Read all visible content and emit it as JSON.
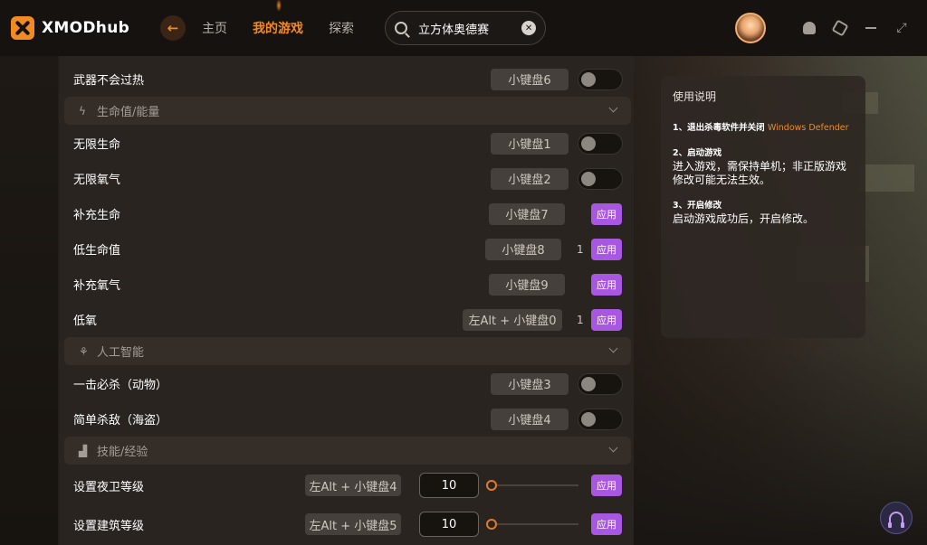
{
  "app": {
    "name": "XMODhub"
  },
  "nav": {
    "items": [
      "主页",
      "我的游戏",
      "探索"
    ],
    "active_index": 1
  },
  "search": {
    "value": "立方体奥德赛"
  },
  "colors": {
    "accent": "#f08a24",
    "apply": "#a857e0",
    "panel": "#2a2420"
  },
  "rows": {
    "r0": {
      "label": "武器不会过热",
      "hotkey": "小键盘6",
      "control": "toggle",
      "on": false
    },
    "sec1": {
      "label": "生命值/能量",
      "icon": "lightning-icon"
    },
    "r1": {
      "label": "无限生命",
      "hotkey": "小键盘1",
      "control": "toggle",
      "on": false
    },
    "r2": {
      "label": "无限氧气",
      "hotkey": "小键盘2",
      "control": "toggle",
      "on": false
    },
    "r3": {
      "label": "补充生命",
      "hotkey": "小键盘7",
      "apply": "应用"
    },
    "r4": {
      "label": "低生命值",
      "hotkey": "小键盘8",
      "value": "1",
      "apply": "应用"
    },
    "r5": {
      "label": "补充氧气",
      "hotkey": "小键盘9",
      "apply": "应用"
    },
    "r6": {
      "label": "低氧",
      "hotkey": "左Alt + 小键盘0",
      "value": "1",
      "apply": "应用"
    },
    "sec2": {
      "label": "人工智能",
      "icon": "ai-icon"
    },
    "r7": {
      "label": "一击必杀（动物）",
      "hotkey": "小键盘3",
      "control": "toggle",
      "on": false
    },
    "r8": {
      "label": "简单杀敌（海盗）",
      "hotkey": "小键盘4",
      "control": "toggle",
      "on": false
    },
    "sec3": {
      "label": "技能/经验",
      "icon": "stats-icon"
    },
    "r9": {
      "label": "设置夜卫等级",
      "hotkey": "左Alt + 小键盘4",
      "input": "10",
      "slider_fraction": 0,
      "apply": "应用"
    },
    "r10": {
      "label": "设置建筑等级",
      "hotkey": "左Alt + 小键盘5",
      "input": "10",
      "slider_fraction": 0,
      "apply": "应用"
    }
  },
  "info": {
    "title": "使用说明",
    "step1_title": "1、退出杀毒软件并关闭",
    "step1_link": "Windows Defender",
    "step2_title": "2、启动游戏",
    "step2_body": "进入游戏，需保持单机；非正版游戏修改可能无法生效。",
    "step3_title": "3、开启修改",
    "step3_body": "启动游戏成功后，开启修改。"
  }
}
